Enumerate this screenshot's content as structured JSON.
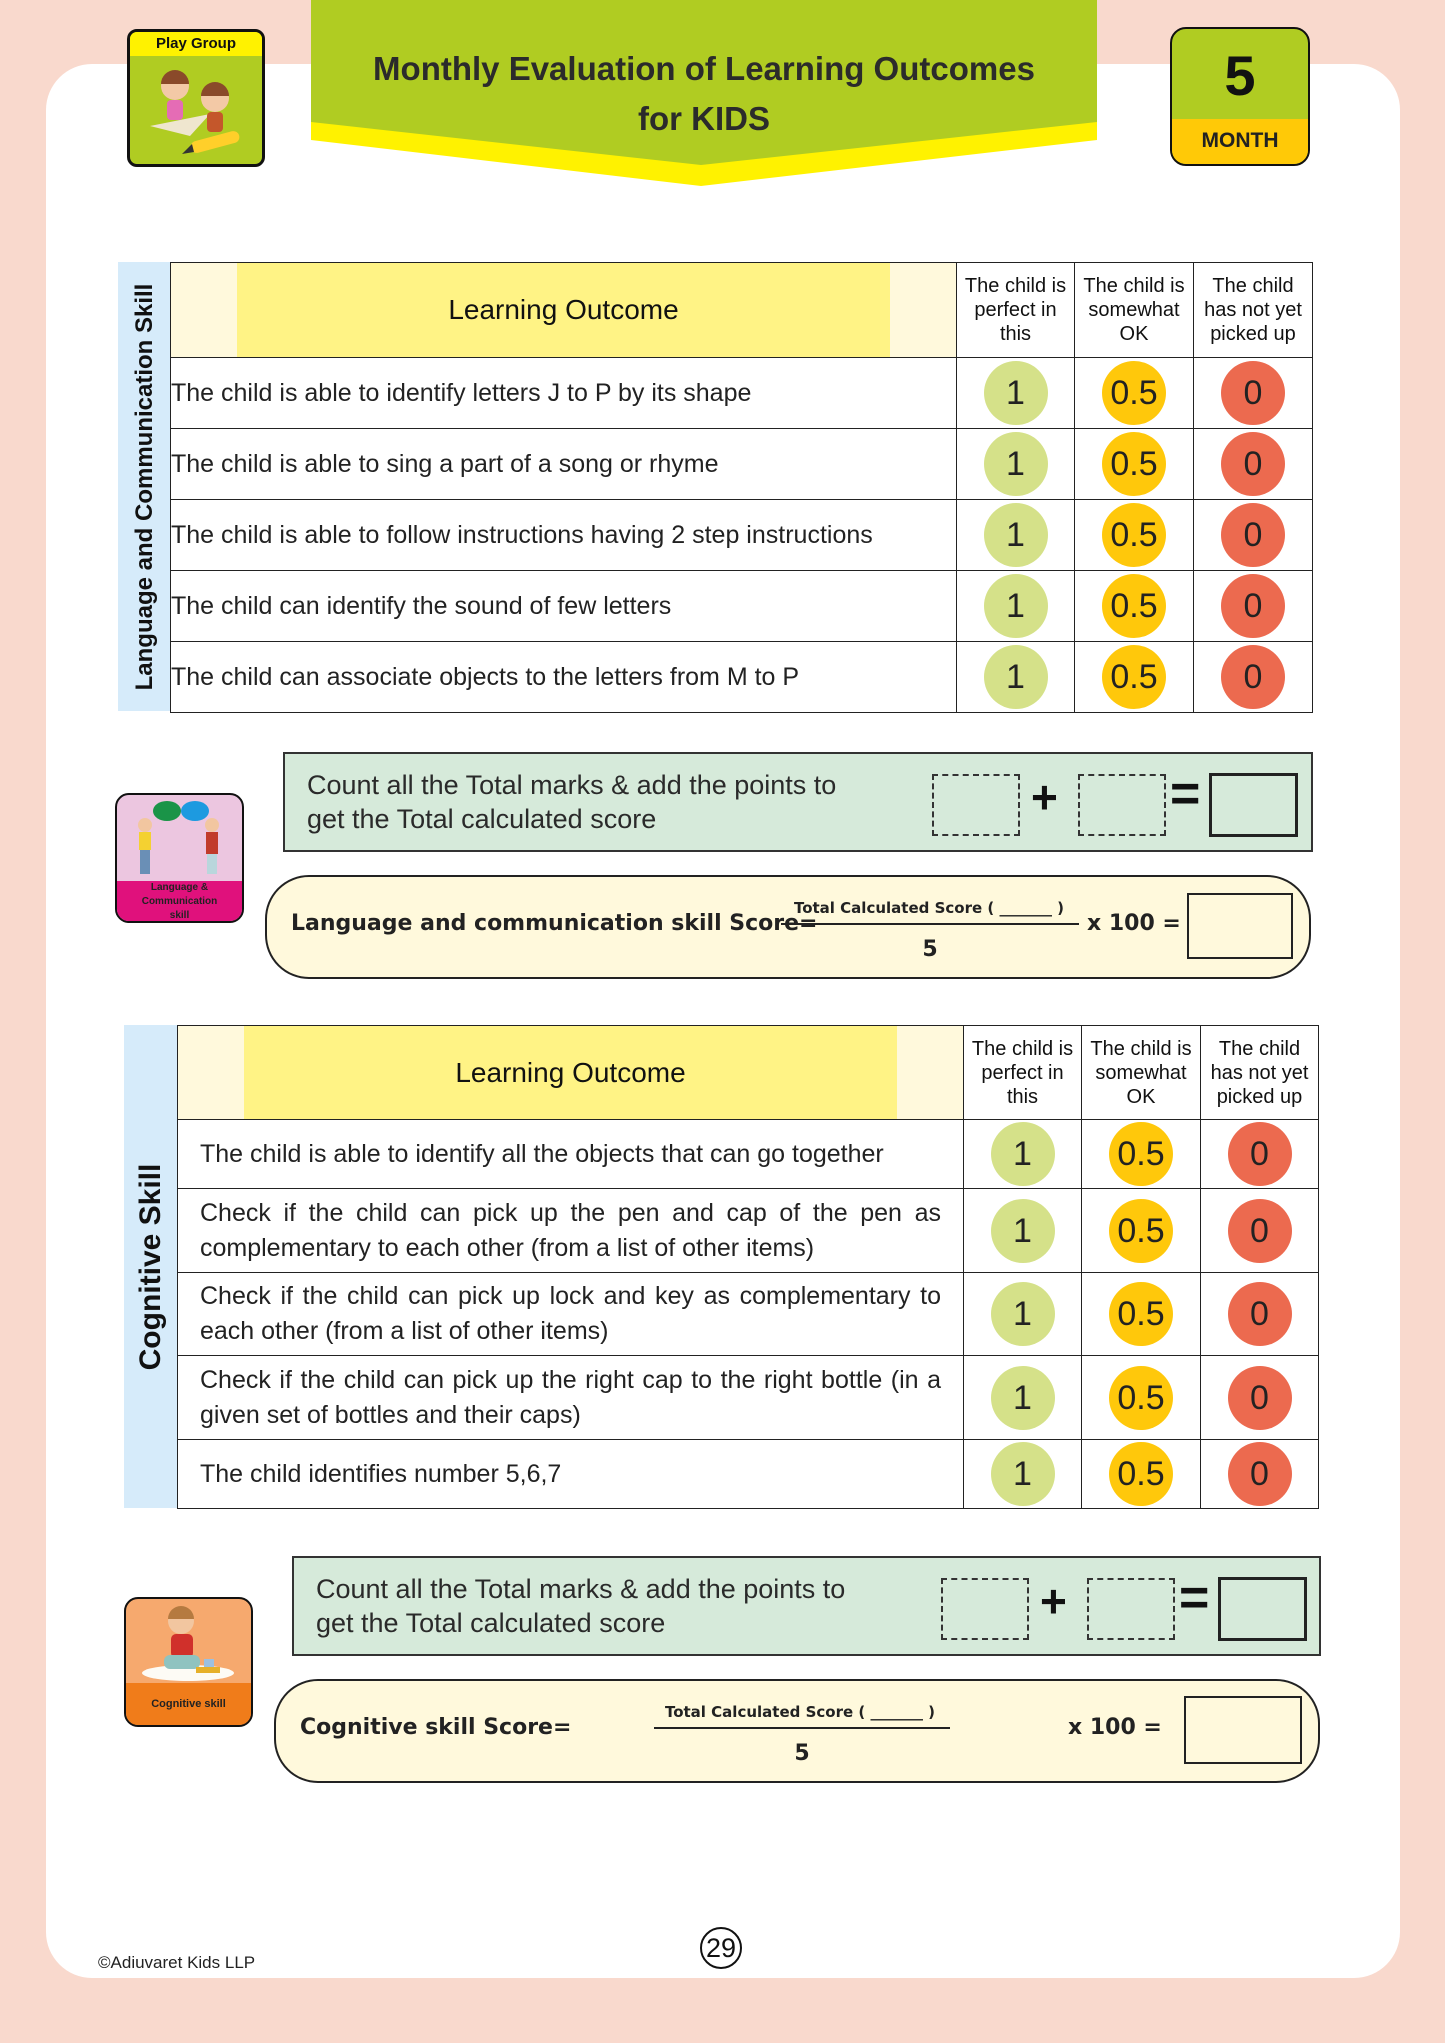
{
  "header": {
    "title_line1": "Monthly Evaluation of Learning Outcomes",
    "title_line2": "for KIDS",
    "level_badge": "Play Group",
    "month_number": "5",
    "month_label": "MONTH"
  },
  "colors": {
    "banner_green": "#b0cc22",
    "banner_yellow": "#fff200",
    "score_perfect": "#d5e189",
    "score_ok": "#ffc80b",
    "score_not_yet": "#ec6a4f",
    "page_border": "#f9d9cd"
  },
  "sections": [
    {
      "label": "Language and Communication Skill",
      "header": {
        "learning_outcome": "Learning Outcome",
        "col_perfect": "The child is perfect in this",
        "col_ok": "The child is somewhat OK",
        "col_not_yet": "The child has not yet picked up"
      },
      "rows": [
        {
          "outcome": "The child is able to identify letters J to P by its shape",
          "scores": [
            "1",
            "0.5",
            "0"
          ]
        },
        {
          "outcome": "The child is able to sing a part of a song or rhyme",
          "scores": [
            "1",
            "0.5",
            "0"
          ]
        },
        {
          "outcome": "The child is able to follow instructions having 2 step instructions",
          "scores": [
            "1",
            "0.5",
            "0"
          ]
        },
        {
          "outcome": "The child can identify the sound of few letters",
          "scores": [
            "1",
            "0.5",
            "0"
          ]
        },
        {
          "outcome": "The child can associate objects to the letters from M to P",
          "scores": [
            "1",
            "0.5",
            "0"
          ]
        }
      ],
      "icon_caption": "Language & Communication skill",
      "count_text": "Count all the Total marks & add the points to get the Total calculated score",
      "count_plus": "+",
      "count_equals": "=",
      "formula_name": "Language and communication skill Score=",
      "formula_numerator": "Total Calculated Score ( _______ )",
      "formula_denominator": "5",
      "formula_multiplier": "x 100 ="
    },
    {
      "label": "Cognitive Skill",
      "header": {
        "learning_outcome": "Learning Outcome",
        "col_perfect": "The child is perfect in this",
        "col_ok": "The child is somewhat OK",
        "col_not_yet": "The child has not yet picked up"
      },
      "rows": [
        {
          "outcome": "The child is able to identify all the objects that can go together",
          "scores": [
            "1",
            "0.5",
            "0"
          ]
        },
        {
          "outcome": "Check if the child can pick up the pen and cap of the pen as complementary to each other (from a list of other items)",
          "scores": [
            "1",
            "0.5",
            "0"
          ]
        },
        {
          "outcome": "Check if the child can pick up lock and key as complementary to each other (from a list of other items)",
          "scores": [
            "1",
            "0.5",
            "0"
          ]
        },
        {
          "outcome": "Check if the child can pick up the right cap to the right bottle (in a given set of bottles and their caps)",
          "scores": [
            "1",
            "0.5",
            "0"
          ]
        },
        {
          "outcome": "The child identifies number 5,6,7",
          "scores": [
            "1",
            "0.5",
            "0"
          ]
        }
      ],
      "icon_caption": "Cognitive skill",
      "count_text": "Count all the Total marks & add the points to get the Total calculated score",
      "count_plus": "+",
      "count_equals": "=",
      "formula_name": "Cognitive skill Score=",
      "formula_numerator": "Total Calculated Score ( _______ )",
      "formula_denominator": "5",
      "formula_multiplier": "x 100 ="
    }
  ],
  "footer": {
    "copyright": "©Adiuvaret Kids LLP",
    "page_number": "29"
  }
}
